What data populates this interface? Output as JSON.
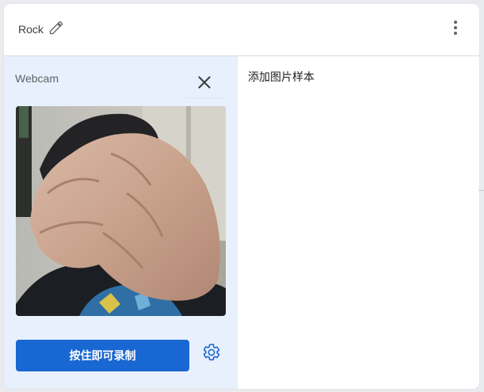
{
  "header": {
    "class_name": "Rock"
  },
  "webcam": {
    "label": "Webcam",
    "record_label": "按住即可录制"
  },
  "samples": {
    "title": "添加图片样本"
  },
  "icons": {
    "edit": "pencil-icon",
    "more": "more-vert-icon",
    "close": "close-icon",
    "settings": "gear-icon"
  },
  "colors": {
    "accent": "#1967d2",
    "panel_bg": "#e8f0fe"
  }
}
